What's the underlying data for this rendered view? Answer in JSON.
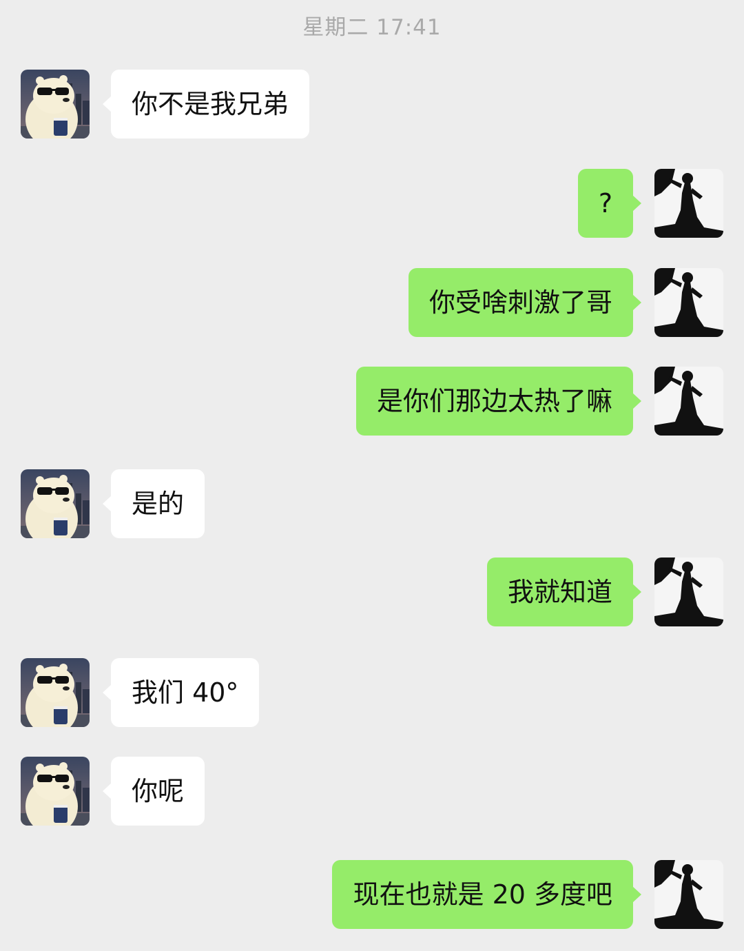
{
  "chat": {
    "timestamp": "星期二 17:41",
    "messages": [
      {
        "side": "left",
        "text": "你不是我兄弟"
      },
      {
        "side": "right",
        "text": "?"
      },
      {
        "side": "right",
        "text": "你受啥刺激了哥"
      },
      {
        "side": "right",
        "text": "是你们那边太热了嘛"
      },
      {
        "side": "left",
        "text": "是的"
      },
      {
        "side": "right",
        "text": "我就知道"
      },
      {
        "side": "left",
        "text": "我们 40°"
      },
      {
        "side": "left",
        "text": "你呢"
      },
      {
        "side": "right",
        "text": "现在也就是 20 多度吧"
      }
    ]
  },
  "avatars": {
    "contact": "polar-bear-sunglasses-avatar",
    "self": "silhouette-figure-avatar"
  },
  "colors": {
    "background": "#ededed",
    "incoming_bubble": "#ffffff",
    "outgoing_bubble": "#95ec69",
    "timestamp_text": "#a9a9a9"
  }
}
